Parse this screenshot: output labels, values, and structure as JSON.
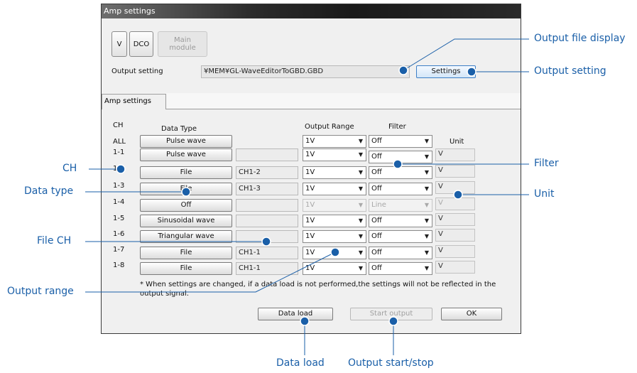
{
  "window": {
    "title": "Amp settings",
    "top_buttons": [
      {
        "label": "V"
      },
      {
        "label": "DCO"
      },
      {
        "label": "Main\nmodule"
      }
    ],
    "output_setting_label": "Output setting",
    "output_file": "¥MEM¥GL-WaveEditorToGBD.GBD",
    "settings_button": "Settings",
    "tab_label": "Amp settings",
    "headers": {
      "ch": "CH",
      "data_type": "Data Type",
      "output_range": "Output Range",
      "filter": "Filter",
      "unit": "Unit"
    },
    "all_row": {
      "ch": "ALL",
      "data_type": "Pulse wave",
      "range": "1V",
      "filter": "Off"
    },
    "rows": [
      {
        "ch": "1-1",
        "data_type": "Pulse wave",
        "file_ch": "",
        "range": "1V",
        "filter": "Off",
        "unit": "V"
      },
      {
        "ch": "1-2",
        "data_type": "File",
        "file_ch": "CH1-2",
        "range": "1V",
        "filter": "Off",
        "unit": "V"
      },
      {
        "ch": "1-3",
        "data_type": "File",
        "file_ch": "CH1-3",
        "range": "1V",
        "filter": "Off",
        "unit": "V"
      },
      {
        "ch": "1-4",
        "data_type": "Off",
        "file_ch": "",
        "range": "1V",
        "filter": "Line",
        "unit": "V"
      },
      {
        "ch": "1-5",
        "data_type": "Sinusoidal wave",
        "file_ch": "",
        "range": "1V",
        "filter": "Off",
        "unit": "V"
      },
      {
        "ch": "1-6",
        "data_type": "Triangular wave",
        "file_ch": "",
        "range": "1V",
        "filter": "Off",
        "unit": "V"
      },
      {
        "ch": "1-7",
        "data_type": "File",
        "file_ch": "CH1-1",
        "range": "1V",
        "filter": "Off",
        "unit": "V"
      },
      {
        "ch": "1-8",
        "data_type": "File",
        "file_ch": "CH1-1",
        "range": "1V",
        "filter": "Off",
        "unit": "V"
      }
    ],
    "note": "* When settings are changed, if a data load is not performed,the settings will not be reflected in the output signal.",
    "data_load_button": "Data load",
    "start_output_button": "Start output",
    "ok_button": "OK"
  },
  "callouts": {
    "output_file_display": "Output file display",
    "output_setting": "Output setting",
    "ch": "CH",
    "filter": "Filter",
    "data_type": "Data type",
    "unit": "Unit",
    "file_ch": "File CH",
    "output_range": "Output range",
    "data_load": "Data load",
    "output_start_stop": "Output start/stop"
  },
  "colors": {
    "callout_blue": "#1a5fa8",
    "title_bar_dark": "#1a1a1a",
    "window_bg": "#f0f0f0"
  }
}
